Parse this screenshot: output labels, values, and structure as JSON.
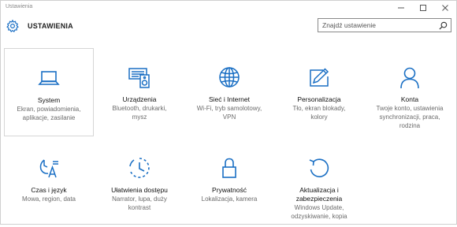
{
  "window": {
    "title": "Ustawienia"
  },
  "header": {
    "title": "USTAWIENIA",
    "search_placeholder": "Znajdź ustawienie"
  },
  "accent": "#1a6fc4",
  "tiles": [
    {
      "name": "System",
      "desc": "Ekran, powiadomienia,\naplikacje, zasilanie",
      "icon": "laptop-icon"
    },
    {
      "name": "Urządzenia",
      "desc": "Bluetooth, drukarki,\nmysz",
      "icon": "devices-icon"
    },
    {
      "name": "Sieć i Internet",
      "desc": "Wi-Fi, tryb samolotowy,\nVPN",
      "icon": "globe-icon"
    },
    {
      "name": "Personalizacja",
      "desc": "Tło, ekran blokady,\nkolory",
      "icon": "paint-icon"
    },
    {
      "name": "Konta",
      "desc": "Twoje konto, ustawienia\nsynchronizacji, praca,\nrodzina",
      "icon": "person-icon"
    },
    {
      "name": "Czas i język",
      "desc": "Mowa, region, data",
      "icon": "time-language-icon"
    },
    {
      "name": "Ułatwienia dostępu",
      "desc": "Narrator, lupa, duży\nkontrast",
      "icon": "ease-of-access-icon"
    },
    {
      "name": "Prywatność",
      "desc": "Lokalizacja, kamera",
      "icon": "lock-icon"
    },
    {
      "name": "Aktualizacja i\nzabezpieczenia",
      "desc": "Windows Update,\nodzyskiwanie, kopia",
      "icon": "update-icon"
    }
  ]
}
